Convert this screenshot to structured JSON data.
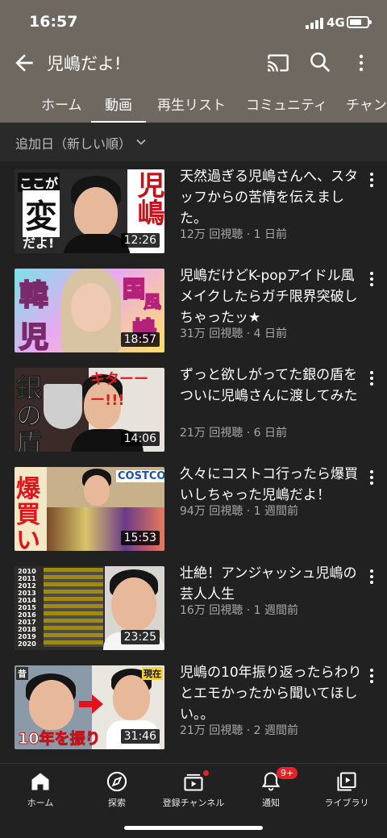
{
  "status": {
    "time": "16:57",
    "network": "4G"
  },
  "header": {
    "title": "児嶋だよ!"
  },
  "tabs": [
    "ホーム",
    "動画",
    "再生リスト",
    "コミュニティ",
    "チャンネル"
  ],
  "sort": {
    "label": "追加日（新しい順）"
  },
  "videos": [
    {
      "title": "天然過ぎる児嶋さんへ、スタッフからの苦情を伝えました。",
      "meta": "12万 回視聴 · 1 日前",
      "duration": "12:26",
      "thumb_text": [
        "ここが",
        "変",
        "だよ!",
        "児嶋"
      ]
    },
    {
      "title": "児嶋だけどK-popアイドル風メイクしたらガチ限界突破しちゃったッ★",
      "meta": "31万 回視聴 · 4 日前",
      "duration": "18:57",
      "thumb_text": [
        "韓",
        "国",
        "風",
        "児",
        "嶋"
      ]
    },
    {
      "title": "ずっと欲しがってた銀の盾をついに児嶋さんに渡してみた",
      "meta": "21万 回視聴 · 6 日前",
      "duration": "14:06",
      "thumb_text": [
        "銀",
        "の",
        "盾",
        "キターーー!!!"
      ]
    },
    {
      "title": "久々にコストコ行ったら爆買いしちゃった児嶋だよ！",
      "meta": "94万 回視聴 · 1 週間前",
      "duration": "15:53",
      "thumb_text": [
        "爆",
        "買",
        "い",
        "COSTCO"
      ]
    },
    {
      "title": "壮絶！アンジャッシュ児嶋の芸人人生",
      "meta": "16万 回視聴 · 1 週間前",
      "duration": "23:25",
      "thumb_text": [
        "2010",
        "2011",
        "2012",
        "2013",
        "2014",
        "2015",
        "2016",
        "2017",
        "2018",
        "2019",
        "2020"
      ]
    },
    {
      "title": "児嶋の10年振り返ったらわりとエモかったから聞いてほしい。。",
      "meta": "21万 回視聴 · 2 週間前",
      "duration": "31:46",
      "thumb_text": [
        "昔",
        "現在",
        "10年を振り"
      ]
    }
  ],
  "nav": [
    {
      "label": "ホーム",
      "icon": "home-icon"
    },
    {
      "label": "探索",
      "icon": "explore-icon"
    },
    {
      "label": "登録チャンネル",
      "icon": "subscriptions-icon"
    },
    {
      "label": "通知",
      "icon": "bell-icon",
      "badge": "9+"
    },
    {
      "label": "ライブラリ",
      "icon": "library-icon"
    }
  ]
}
